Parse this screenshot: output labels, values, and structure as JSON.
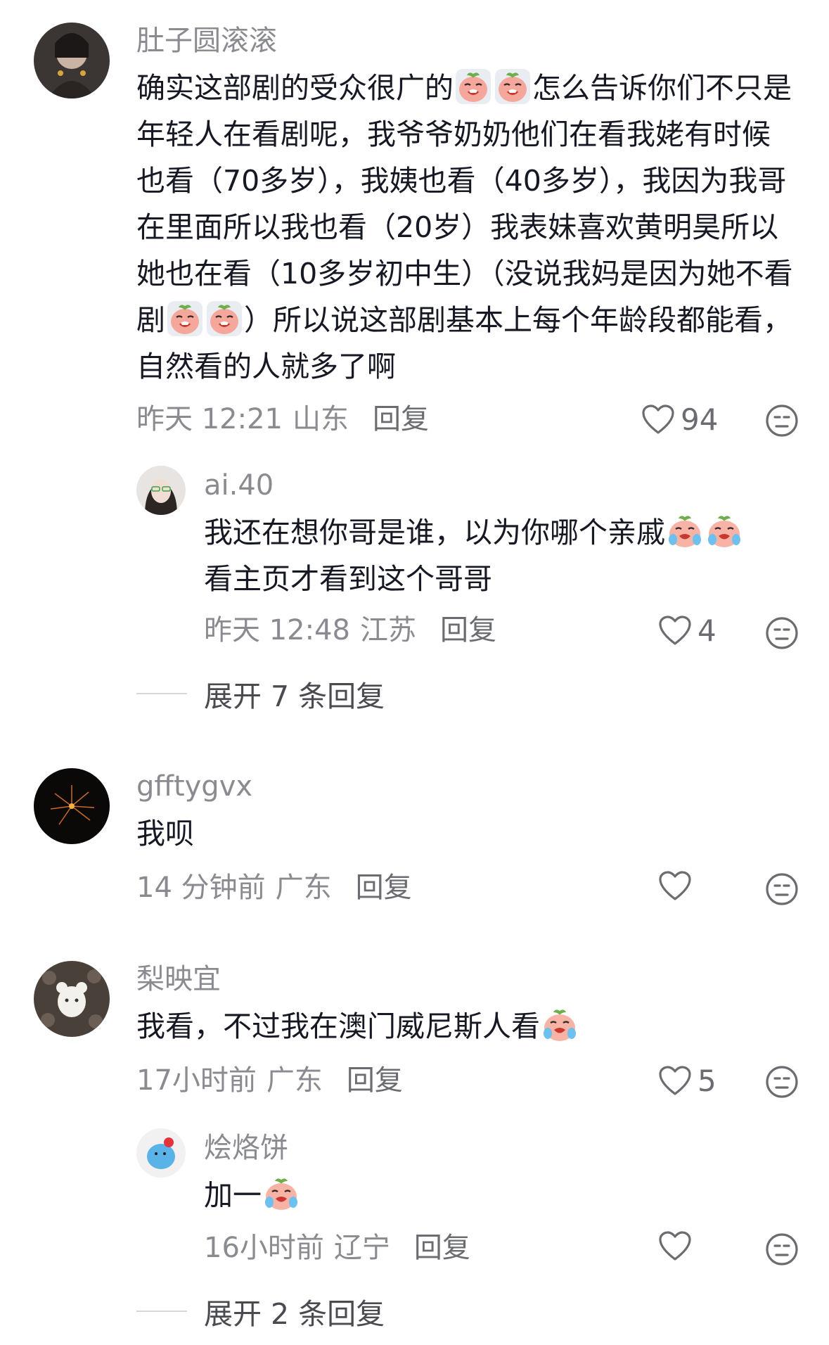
{
  "comments": [
    {
      "username": "肚子圆滚滚",
      "text_a": "确实这部剧的受众很广的",
      "text_b": "怎么告诉你们不只是年轻人在看剧呢，我爷爷奶奶他们在看我姥有时候也看（70多岁），我姨也看（40多岁），我因为我哥在里面所以我也看（20岁）我表妹喜欢黄明昊所以她也在看（10多岁初中生）（没说我妈是因为她不看剧",
      "text_c": "）所以说这部剧基本上每个年龄段都能看，自然看的人就多了啊",
      "time": "昨天 12:21",
      "location": "山东",
      "reply_label": "回复",
      "likes": "94",
      "emoji": "sob-face"
    },
    {
      "username": "ai.40",
      "text_a": "我还在想你哥是谁，以为你哪个亲戚",
      "text_b": "看主页才看到这个哥哥",
      "time": "昨天 12:48",
      "location": "江苏",
      "reply_label": "回复",
      "likes": "4",
      "emoji": "crying-face"
    },
    {
      "expand_label": "展开 7 条回复"
    },
    {
      "username": "gfftygvx",
      "text_a": "我呗",
      "time": "14 分钟前",
      "location": "广东",
      "reply_label": "回复",
      "likes": ""
    },
    {
      "username": "梨映宜",
      "text_a": "我看，不过我在澳门威尼斯人看",
      "time": "17小时前",
      "location": "广东",
      "reply_label": "回复",
      "likes": "5",
      "emoji": "crying-face"
    },
    {
      "username": "烩烙饼",
      "text_a": "加一",
      "time": "16小时前",
      "location": "辽宁",
      "reply_label": "回复",
      "likes": "",
      "emoji": "crying-face"
    },
    {
      "expand_label": "展开 2 条回复"
    }
  ],
  "colors": {
    "text": "#161823",
    "meta": "#8a8b91",
    "icon": "#6b6c72"
  }
}
